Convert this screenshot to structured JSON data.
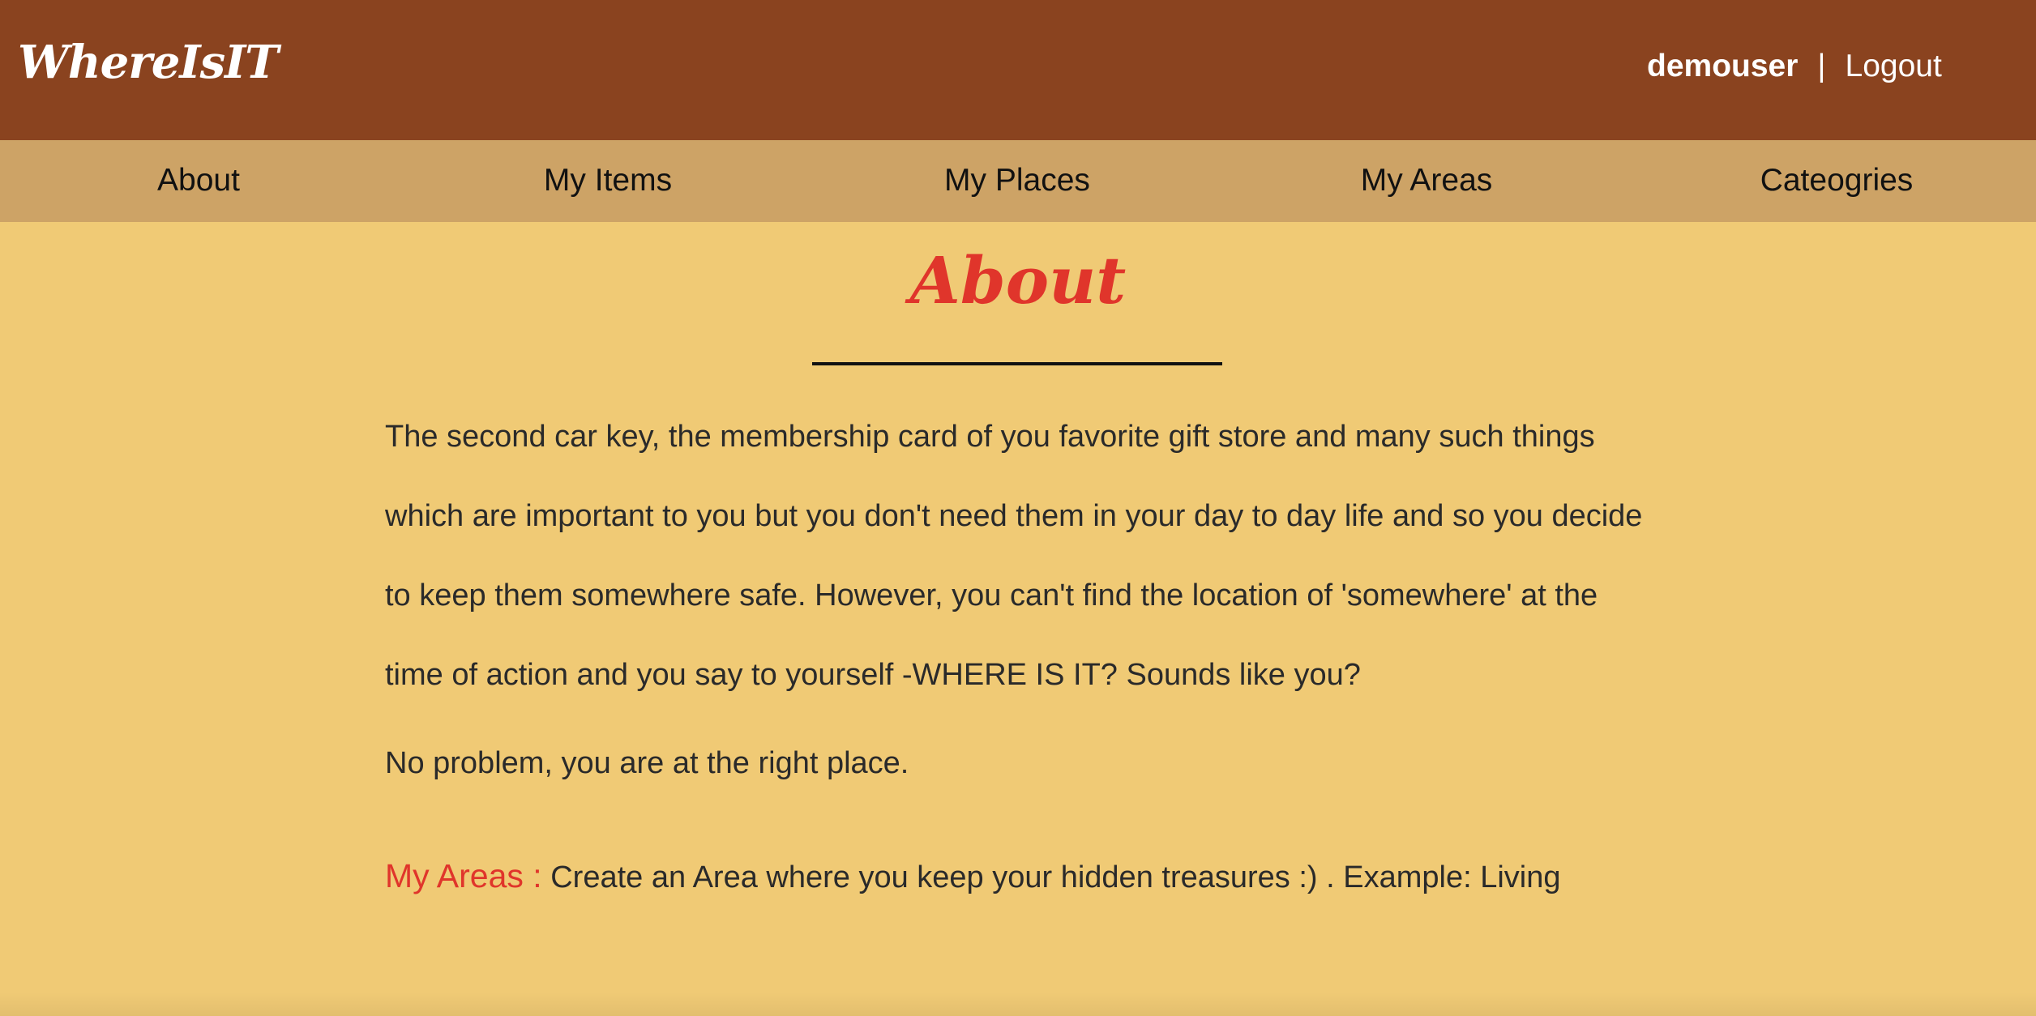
{
  "header": {
    "logo": "WhereIsIT",
    "username": "demouser",
    "separator": "|",
    "logout_label": "Logout"
  },
  "nav": {
    "items": [
      {
        "label": "About"
      },
      {
        "label": "My Items"
      },
      {
        "label": "My Places"
      },
      {
        "label": "My Areas"
      },
      {
        "label": "Cateogries"
      }
    ]
  },
  "page": {
    "title": "About",
    "paragraphs": [
      "The second car key, the membership card of you favorite gift store and many such things which are important to you but you don't need them in your day to day life and so you decide to keep them somewhere safe. However, you can't find the location of 'somewhere' at the time of action and you say to yourself -WHERE IS IT? Sounds like you?",
      "No problem, you are at the right place."
    ],
    "sections": [
      {
        "label": "My Areas :",
        "text": " Create an Area where you keep your hidden treasures :) . Example: Living"
      }
    ]
  },
  "colors": {
    "header_bg": "#8a431f",
    "nav_bg": "#cda366",
    "page_bg": "#f0ca75",
    "accent": "#e0352b"
  }
}
